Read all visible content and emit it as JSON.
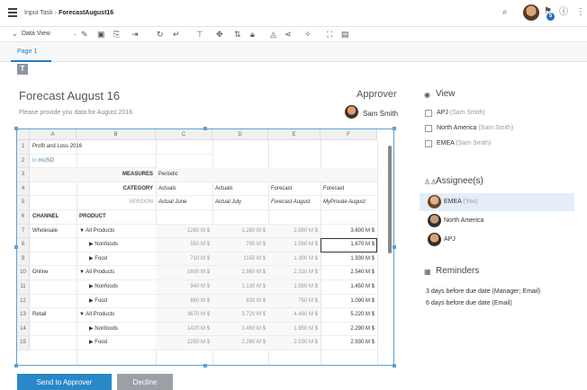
{
  "topbar": {
    "crumb_parent": "Input Task",
    "crumb_current": "ForecastAugust16",
    "notification_count": "5",
    "icons": [
      "menu-icon",
      "search-icon",
      "avatar",
      "notification-icon",
      "help-icon",
      "more-icon"
    ]
  },
  "toolbar": {
    "data_view_label": "Data View"
  },
  "tabs": [
    {
      "label": "Page 1"
    }
  ],
  "form": {
    "title": "Forecast August 16",
    "subtitle": "Please provide you data for August 2016",
    "approver_label": "Approver",
    "approver_name": "Sam Smith"
  },
  "sheet": {
    "columns": [
      "A",
      "B",
      "C",
      "D",
      "E",
      "F"
    ],
    "rows": [
      "1",
      "2",
      "3",
      "4",
      "5",
      "6",
      "7",
      "8",
      "9",
      "10",
      "11",
      "12",
      "13",
      "14",
      "15"
    ],
    "title": "Profit and Loss 2016",
    "unit_prefix": "in ",
    "unit": "mUSD",
    "measures_label": "MEASURES",
    "measures_value": "Periodic",
    "category_label": "CATEGORY",
    "version_label": "VERSION",
    "categories": [
      "Actuals",
      "Actuals",
      "Forecast",
      "Forecast"
    ],
    "versions": [
      "Actual June",
      "Actual July",
      "Forecast August",
      "MyPrivate August"
    ],
    "channel_header": "CHANNEL",
    "product_header": "PRODUCT",
    "data_rows": [
      {
        "channel": "Wholesale",
        "product": "▼ All Products",
        "values": [
          "1260 M $",
          "1.280 M $",
          "2.860 M $",
          "3.600 M $"
        ]
      },
      {
        "channel": "",
        "product": "▶ Nonfoods",
        "values": [
          "550 M $",
          "790 M $",
          "1.560 M $",
          "1.670 M $"
        ]
      },
      {
        "channel": "",
        "product": "▶ Food",
        "values": [
          "710 M $",
          "1150 M $",
          "1.300 M $",
          "1.930 M $"
        ]
      },
      {
        "channel": "Online",
        "product": "▼ All Products",
        "values": [
          "1600 M $",
          "1.960 M $",
          "2.310 M $",
          "2.540 M $"
        ]
      },
      {
        "channel": "",
        "product": "▶ Nonfoods",
        "values": [
          "940 M $",
          "1.130 M $",
          "1.560 M $",
          "1.450 M $"
        ]
      },
      {
        "channel": "",
        "product": "▶ Food",
        "values": [
          "660 M $",
          "830 M $",
          "750 M $",
          "1.090 M $"
        ]
      },
      {
        "channel": "Retail",
        "product": "▼ All Products",
        "values": [
          "3670 M $",
          "3.720 M $",
          "4.480 M $",
          "5.220 M $"
        ]
      },
      {
        "channel": "",
        "product": "▶ Nonfoods",
        "values": [
          "1420 M $",
          "1.460 M $",
          "1.950 M $",
          "2.290 M $"
        ]
      },
      {
        "channel": "",
        "product": "▶ Food",
        "values": [
          "2250 M $",
          "2.260 M $",
          "2.530 M $",
          "2.930 M $"
        ]
      }
    ]
  },
  "actions": {
    "send_label": "Send to Approver",
    "decline_label": "Decline"
  },
  "right_panel": {
    "view_title": "View",
    "view_items": [
      {
        "label": "APJ",
        "owner": "(Sam Smith)"
      },
      {
        "label": "North America",
        "owner": "(Sam Smith)"
      },
      {
        "label": "EMEA",
        "owner": "(Sam Smith)"
      }
    ],
    "assignee_title": "Assignee(s)",
    "assignees": [
      {
        "label": "EMEA",
        "note": "(You)"
      },
      {
        "label": "North America",
        "note": ""
      },
      {
        "label": "APJ",
        "note": ""
      }
    ],
    "reminders_title": "Reminders",
    "reminders": [
      "3 days before due date (Manager; Email)",
      "6 days before due date (Email)"
    ]
  },
  "colors": {
    "accent": "#2a87c8",
    "selection_border": "#5aa0d8",
    "active_row": "#e4eef8"
  }
}
